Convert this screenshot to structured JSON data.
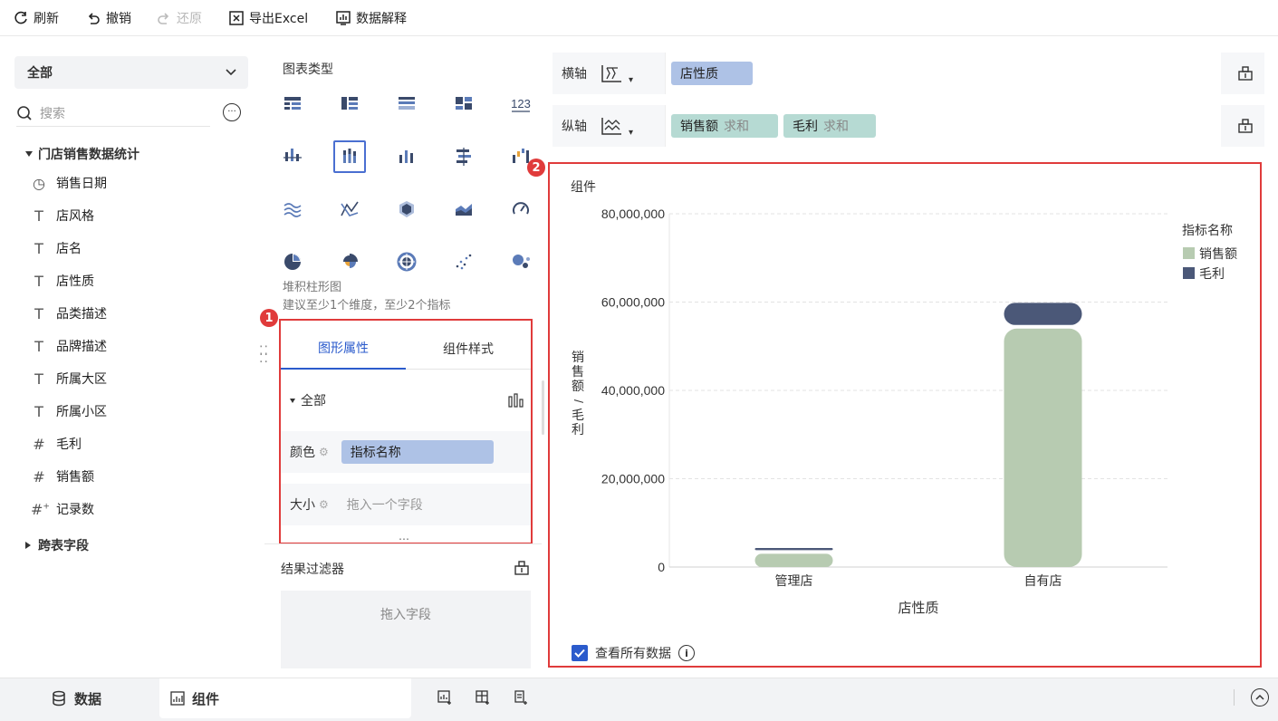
{
  "toolbar": {
    "refresh": "刷新",
    "undo": "撤销",
    "redo": "还原",
    "export": "导出Excel",
    "explain": "数据解释"
  },
  "left": {
    "dropdown": "全部",
    "search_placeholder": "搜索",
    "tree_root": "门店销售数据统计",
    "fields": [
      {
        "icon": "clock-icon",
        "label": "销售日期"
      },
      {
        "icon": "text-type-icon",
        "label": "店风格"
      },
      {
        "icon": "text-type-icon",
        "label": "店名"
      },
      {
        "icon": "text-type-icon",
        "label": "店性质"
      },
      {
        "icon": "text-type-icon",
        "label": "品类描述"
      },
      {
        "icon": "text-type-icon",
        "label": "品牌描述"
      },
      {
        "icon": "text-type-icon",
        "label": "所属大区"
      },
      {
        "icon": "text-type-icon",
        "label": "所属小区"
      },
      {
        "icon": "number-type-icon",
        "label": "毛利"
      },
      {
        "icon": "number-type-icon",
        "label": "销售额"
      },
      {
        "icon": "count-type-icon",
        "label": "记录数"
      }
    ],
    "cross_table": "跨表字段"
  },
  "middle": {
    "chart_type_title": "图表类型",
    "chart_type_text": "123",
    "selected_type_name": "堆积柱形图",
    "selected_type_hint": "建议至少1个维度，至少2个指标",
    "tabs": [
      "图形属性",
      "组件样式"
    ],
    "prop_section": "全部",
    "color_label": "颜色",
    "color_value": "指标名称",
    "size_label": "大小",
    "size_placeholder": "拖入一个字段",
    "filter_title": "结果过滤器",
    "filter_placeholder": "拖入字段",
    "badge1": "1"
  },
  "axes": {
    "x_label": "横轴",
    "x_field": "店性质",
    "y_label": "纵轴",
    "y_fields": [
      {
        "name": "销售额",
        "agg": "求和"
      },
      {
        "name": "毛利",
        "agg": "求和"
      }
    ]
  },
  "chart_panel": {
    "badge2": "2",
    "title": "组件",
    "view_all": "查看所有数据"
  },
  "colors": {
    "sales": "#b7cbb1",
    "profit": "#4b5878",
    "accent": "#2b5bcc",
    "highlight": "#e03b3b"
  },
  "chart_data": {
    "type": "bar",
    "stacked": true,
    "categories": [
      "管理店",
      "自有店"
    ],
    "series": [
      {
        "name": "销售额",
        "values": [
          3000000,
          54000000
        ],
        "color": "#b7cbb1"
      },
      {
        "name": "毛利",
        "values": [
          500000,
          5000000
        ],
        "color": "#4b5878"
      }
    ],
    "xlabel": "店性质",
    "ylabel": "销售额/毛利",
    "ylim": [
      0,
      80000000
    ],
    "yticks": [
      "0",
      "20,000,000",
      "40,000,000",
      "60,000,000",
      "80,000,000"
    ],
    "ytick_values": [
      0,
      20000000,
      40000000,
      60000000,
      80000000
    ],
    "legend_title": "指标名称",
    "legend_position": "top-right",
    "grid": true
  },
  "bottom": {
    "data_tab": "数据",
    "component_tab": "组件"
  }
}
